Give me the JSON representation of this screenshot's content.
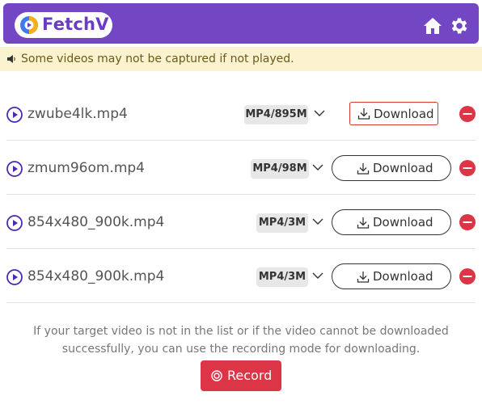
{
  "header": {
    "app_name": "FetchV",
    "brand_color": "#7346c4",
    "icons": [
      "logo-icon",
      "home-icon",
      "gear-icon"
    ]
  },
  "notice": {
    "text": "Some videos may not be captured if not played.",
    "icon": "speaker-icon"
  },
  "videos": [
    {
      "name": "zwube4lk.mp4",
      "format": "MP4/895M",
      "download_label": "Download"
    },
    {
      "name": "zmum96om.mp4",
      "format": "MP4/98M",
      "download_label": "Download"
    },
    {
      "name": "854x480_900k.mp4",
      "format": "MP4/3M",
      "download_label": "Download"
    },
    {
      "name": "854x480_900k.mp4",
      "format": "MP4/3M",
      "download_label": "Download"
    }
  ],
  "footer": {
    "hint": "If your target video is not in the list or if the video cannot be downloaded successfully, you can use the recording mode for downloading.",
    "record_label": "Record",
    "record_color": "#dc3545"
  }
}
